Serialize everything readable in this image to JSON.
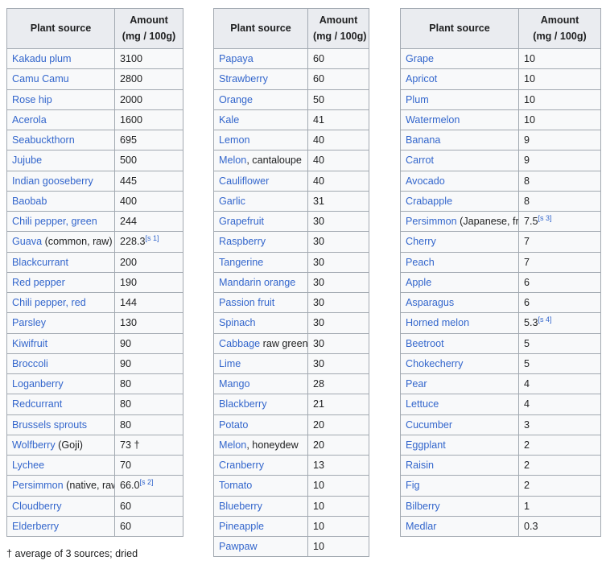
{
  "headers": {
    "plant_source": "Plant source",
    "amount_line1": "Amount",
    "amount_line2": "(mg / 100g)"
  },
  "footnote": "† average of 3 sources; dried",
  "colors": {
    "link": "#3366cc",
    "text": "#202122",
    "header_bg": "#eaecf0",
    "cell_bg": "#f8f9fa",
    "border": "#a2a9b1"
  },
  "tables": [
    {
      "id": "table-1",
      "rows": [
        {
          "link": "Kakadu plum",
          "plain": "",
          "amount": "3100",
          "ref": ""
        },
        {
          "link": "Camu Camu",
          "plain": "",
          "amount": "2800",
          "ref": ""
        },
        {
          "link": "Rose hip",
          "plain": "",
          "amount": "2000",
          "ref": ""
        },
        {
          "link": "Acerola",
          "plain": "",
          "amount": "1600",
          "ref": ""
        },
        {
          "link": "Seabuckthorn",
          "plain": "",
          "amount": "695",
          "ref": ""
        },
        {
          "link": "Jujube",
          "plain": "",
          "amount": "500",
          "ref": ""
        },
        {
          "link": "Indian gooseberry",
          "plain": "",
          "amount": "445",
          "ref": ""
        },
        {
          "link": "Baobab",
          "plain": "",
          "amount": "400",
          "ref": ""
        },
        {
          "link": "Chili pepper, green",
          "plain": "",
          "amount": "244",
          "ref": ""
        },
        {
          "link": "Guava",
          "plain": " (common, raw)",
          "amount": "228.3",
          "ref": "[s 1]"
        },
        {
          "link": "Blackcurrant",
          "plain": "",
          "amount": "200",
          "ref": ""
        },
        {
          "link": "Red pepper",
          "plain": "",
          "amount": "190",
          "ref": ""
        },
        {
          "link": "Chili pepper, red",
          "plain": "",
          "amount": "144",
          "ref": ""
        },
        {
          "link": "Parsley",
          "plain": "",
          "amount": "130",
          "ref": ""
        },
        {
          "link": "Kiwifruit",
          "plain": "",
          "amount": "90",
          "ref": ""
        },
        {
          "link": "Broccoli",
          "plain": "",
          "amount": "90",
          "ref": ""
        },
        {
          "link": "Loganberry",
          "plain": "",
          "amount": "80",
          "ref": ""
        },
        {
          "link": "Redcurrant",
          "plain": "",
          "amount": "80",
          "ref": ""
        },
        {
          "link": "Brussels sprouts",
          "plain": "",
          "amount": "80",
          "ref": ""
        },
        {
          "link": "Wolfberry",
          "plain": " (Goji)",
          "amount": "73 †",
          "ref": ""
        },
        {
          "link": "Lychee",
          "plain": "",
          "amount": "70",
          "ref": ""
        },
        {
          "link": "Persimmon",
          "plain": " (native, raw)",
          "amount": "66.0",
          "ref": "[s 2]"
        },
        {
          "link": "Cloudberry",
          "plain": "",
          "amount": "60",
          "ref": ""
        },
        {
          "link": "Elderberry",
          "plain": "",
          "amount": "60",
          "ref": ""
        }
      ]
    },
    {
      "id": "table-2",
      "rows": [
        {
          "link": "Papaya",
          "plain": "",
          "amount": "60",
          "ref": ""
        },
        {
          "link": "Strawberry",
          "plain": "",
          "amount": "60",
          "ref": ""
        },
        {
          "link": "Orange",
          "plain": "",
          "amount": "50",
          "ref": ""
        },
        {
          "link": "Kale",
          "plain": "",
          "amount": "41",
          "ref": ""
        },
        {
          "link": "Lemon",
          "plain": "",
          "amount": "40",
          "ref": ""
        },
        {
          "link": "Melon",
          "plain": ", cantaloupe",
          "amount": "40",
          "ref": ""
        },
        {
          "link": "Cauliflower",
          "plain": "",
          "amount": "40",
          "ref": ""
        },
        {
          "link": "Garlic",
          "plain": "",
          "amount": "31",
          "ref": ""
        },
        {
          "link": "Grapefruit",
          "plain": "",
          "amount": "30",
          "ref": ""
        },
        {
          "link": "Raspberry",
          "plain": "",
          "amount": "30",
          "ref": ""
        },
        {
          "link": "Tangerine",
          "plain": "",
          "amount": "30",
          "ref": ""
        },
        {
          "link": "Mandarin orange",
          "plain": "",
          "amount": "30",
          "ref": ""
        },
        {
          "link": "Passion fruit",
          "plain": "",
          "amount": "30",
          "ref": ""
        },
        {
          "link": "Spinach",
          "plain": "",
          "amount": "30",
          "ref": ""
        },
        {
          "link": "Cabbage",
          "plain": " raw green",
          "amount": "30",
          "ref": ""
        },
        {
          "link": "Lime",
          "plain": "",
          "amount": "30",
          "ref": ""
        },
        {
          "link": "Mango",
          "plain": "",
          "amount": "28",
          "ref": ""
        },
        {
          "link": "Blackberry",
          "plain": "",
          "amount": "21",
          "ref": ""
        },
        {
          "link": "Potato",
          "plain": "",
          "amount": "20",
          "ref": ""
        },
        {
          "link": "Melon",
          "plain": ", honeydew",
          "amount": "20",
          "ref": ""
        },
        {
          "link": "Cranberry",
          "plain": "",
          "amount": "13",
          "ref": ""
        },
        {
          "link": "Tomato",
          "plain": "",
          "amount": "10",
          "ref": ""
        },
        {
          "link": "Blueberry",
          "plain": "",
          "amount": "10",
          "ref": ""
        },
        {
          "link": "Pineapple",
          "plain": "",
          "amount": "10",
          "ref": ""
        },
        {
          "link": "Pawpaw",
          "plain": "",
          "amount": "10",
          "ref": ""
        }
      ]
    },
    {
      "id": "table-3",
      "rows": [
        {
          "link": "Grape",
          "plain": "",
          "amount": "10",
          "ref": ""
        },
        {
          "link": "Apricot",
          "plain": "",
          "amount": "10",
          "ref": ""
        },
        {
          "link": "Plum",
          "plain": "",
          "amount": "10",
          "ref": ""
        },
        {
          "link": "Watermelon",
          "plain": "",
          "amount": "10",
          "ref": ""
        },
        {
          "link": "Banana",
          "plain": "",
          "amount": "9",
          "ref": ""
        },
        {
          "link": "Carrot",
          "plain": "",
          "amount": "9",
          "ref": ""
        },
        {
          "link": "Avocado",
          "plain": "",
          "amount": "8",
          "ref": ""
        },
        {
          "link": "Crabapple",
          "plain": "",
          "amount": "8",
          "ref": ""
        },
        {
          "link": "Persimmon",
          "plain": " (Japanese, fresh)",
          "amount": "7.5",
          "ref": "[s 3]"
        },
        {
          "link": "Cherry",
          "plain": "",
          "amount": "7",
          "ref": ""
        },
        {
          "link": "Peach",
          "plain": "",
          "amount": "7",
          "ref": ""
        },
        {
          "link": "Apple",
          "plain": "",
          "amount": "6",
          "ref": ""
        },
        {
          "link": "Asparagus",
          "plain": "",
          "amount": "6",
          "ref": ""
        },
        {
          "link": "Horned melon",
          "plain": "",
          "amount": "5.3",
          "ref": "[s 4]"
        },
        {
          "link": "Beetroot",
          "plain": "",
          "amount": "5",
          "ref": ""
        },
        {
          "link": "Chokecherry",
          "plain": "",
          "amount": "5",
          "ref": ""
        },
        {
          "link": "Pear",
          "plain": "",
          "amount": "4",
          "ref": ""
        },
        {
          "link": "Lettuce",
          "plain": "",
          "amount": "4",
          "ref": ""
        },
        {
          "link": "Cucumber",
          "plain": "",
          "amount": "3",
          "ref": ""
        },
        {
          "link": "Eggplant",
          "plain": "",
          "amount": "2",
          "ref": ""
        },
        {
          "link": "Raisin",
          "plain": "",
          "amount": "2",
          "ref": ""
        },
        {
          "link": "Fig",
          "plain": "",
          "amount": "2",
          "ref": ""
        },
        {
          "link": "Bilberry",
          "plain": "",
          "amount": "1",
          "ref": ""
        },
        {
          "link": "Medlar",
          "plain": "",
          "amount": "0.3",
          "ref": ""
        }
      ]
    }
  ]
}
